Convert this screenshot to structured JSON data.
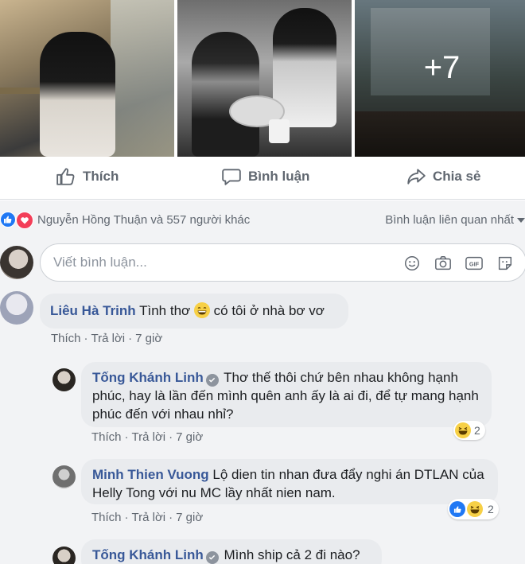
{
  "photos": {
    "more_count": "+7"
  },
  "actions": {
    "like": "Thích",
    "comment": "Bình luận",
    "share": "Chia sẻ"
  },
  "reactions": {
    "summary": "Nguyễn Hồng Thuận và 557 người khác",
    "sort_label": "Bình luận liên quan nhất"
  },
  "composer": {
    "placeholder": "Viết bình luận..."
  },
  "comments": [
    {
      "author": "Liêu Hà Trinh",
      "text_before_emoji": "Tình thơ",
      "text_after_emoji": "có tôi ở nhà bơ vơ",
      "like": "Thích",
      "reply": "Trả lời",
      "time": "7 giờ"
    },
    {
      "author": "Tống Khánh Linh",
      "text": "Thơ thế thôi chứ bên nhau không hạnh phúc, hay là lần đến mình quên anh ấy là ai đi, để tự mang hạnh phúc đến với nhau nhỉ?",
      "like": "Thích",
      "reply": "Trả lời",
      "time": "7 giờ",
      "reaction_count": "2"
    },
    {
      "author": "Minh Thien Vuong",
      "text": "Lộ dien tin nhan đưa đẩy nghi án DTLAN của Helly Tong với nu MC lầy nhất nien nam.",
      "like": "Thích",
      "reply": "Trả lời",
      "time": "7 giờ",
      "reaction_count": "2"
    },
    {
      "author": "Tống Khánh Linh",
      "text": "Mình ship cả 2 đi nào?"
    }
  ],
  "colors": {
    "link_blue": "#385898",
    "like_blue": "#2078f4",
    "love_red": "#f33e58",
    "bubble_gray": "#e9ebee",
    "muted_text": "#606770"
  }
}
